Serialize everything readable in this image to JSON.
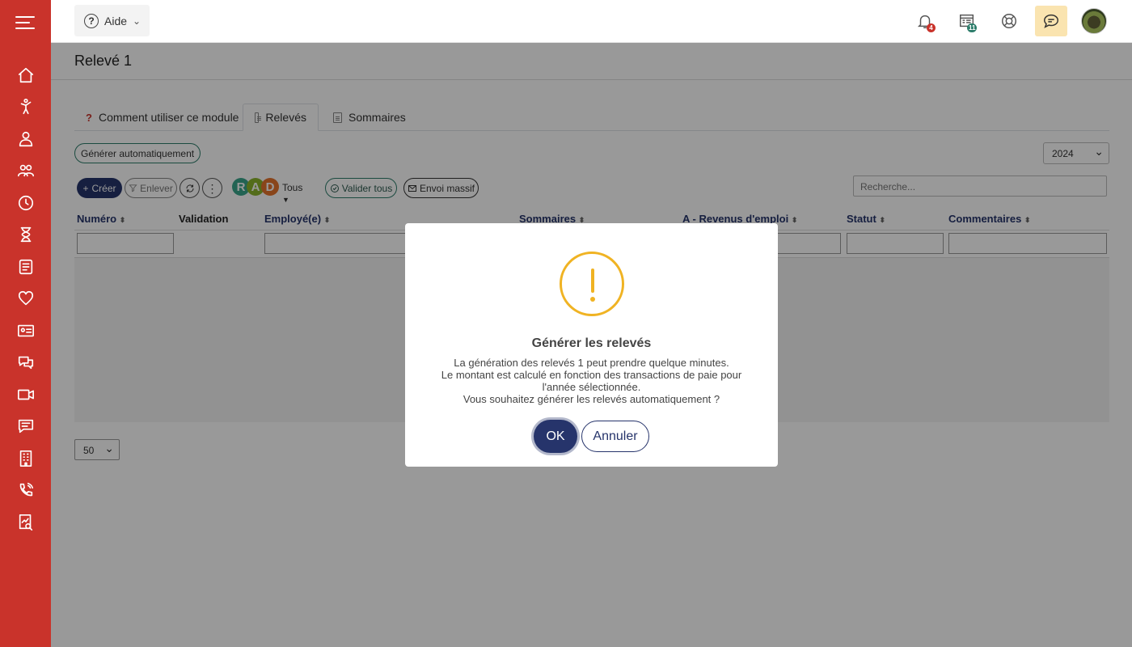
{
  "colors": {
    "sidebar": "#c9332b",
    "primary": "#26346b",
    "accent_green": "#2d7d6b",
    "warning": "#f0b323"
  },
  "sidebar": {
    "items": [
      {
        "icon": "home-icon"
      },
      {
        "icon": "child-icon"
      },
      {
        "icon": "employee-icon"
      },
      {
        "icon": "group-icon"
      },
      {
        "icon": "clock-icon"
      },
      {
        "icon": "hourglass-icon"
      },
      {
        "icon": "checklist-icon"
      },
      {
        "icon": "heart-icon"
      },
      {
        "icon": "id-card-icon"
      },
      {
        "icon": "chat-bubbles-icon"
      },
      {
        "icon": "video-icon"
      },
      {
        "icon": "message-icon"
      },
      {
        "icon": "building-icon"
      },
      {
        "icon": "phone-call-icon"
      },
      {
        "icon": "report-search-icon"
      }
    ]
  },
  "topbar": {
    "help_label": "Aide",
    "help_mark": "?",
    "notifications_badge": "4",
    "calendar_badge": "11"
  },
  "page": {
    "title": "Relevé 1"
  },
  "tabs": [
    {
      "label": "Comment utiliser ce module",
      "icon": "?"
    },
    {
      "label": "Relevés"
    },
    {
      "label": "Sommaires"
    }
  ],
  "toolbar": {
    "generate_label": "Générer automatiquement",
    "year": "2024",
    "create_label": "Créer",
    "create_icon": "+",
    "remove_label": "Enlever",
    "rad": [
      "R",
      "A",
      "D"
    ],
    "rad_colors": [
      "#3aa58a",
      "#8bb52c",
      "#e5732c"
    ],
    "tous_label": "Tous",
    "validate_all_label": "Valider tous",
    "mass_send_label": "Envoi massif",
    "search_placeholder": "Recherche..."
  },
  "table": {
    "columns": [
      "Numéro",
      "Validation",
      "Employé(e)",
      "Sommaires",
      "A - Revenus d'emploi",
      "Statut",
      "Commentaires"
    ],
    "page_size": "50"
  },
  "modal": {
    "title": "Générer les relevés",
    "lines": [
      "La génération des relevés 1 peut prendre quelque minutes.",
      "Le montant est calculé en fonction des transactions de paie pour",
      "l'année sélectionnée.",
      "Vous souhaitez générer les relevés automatiquement ?"
    ],
    "ok_label": "OK",
    "cancel_label": "Annuler"
  }
}
